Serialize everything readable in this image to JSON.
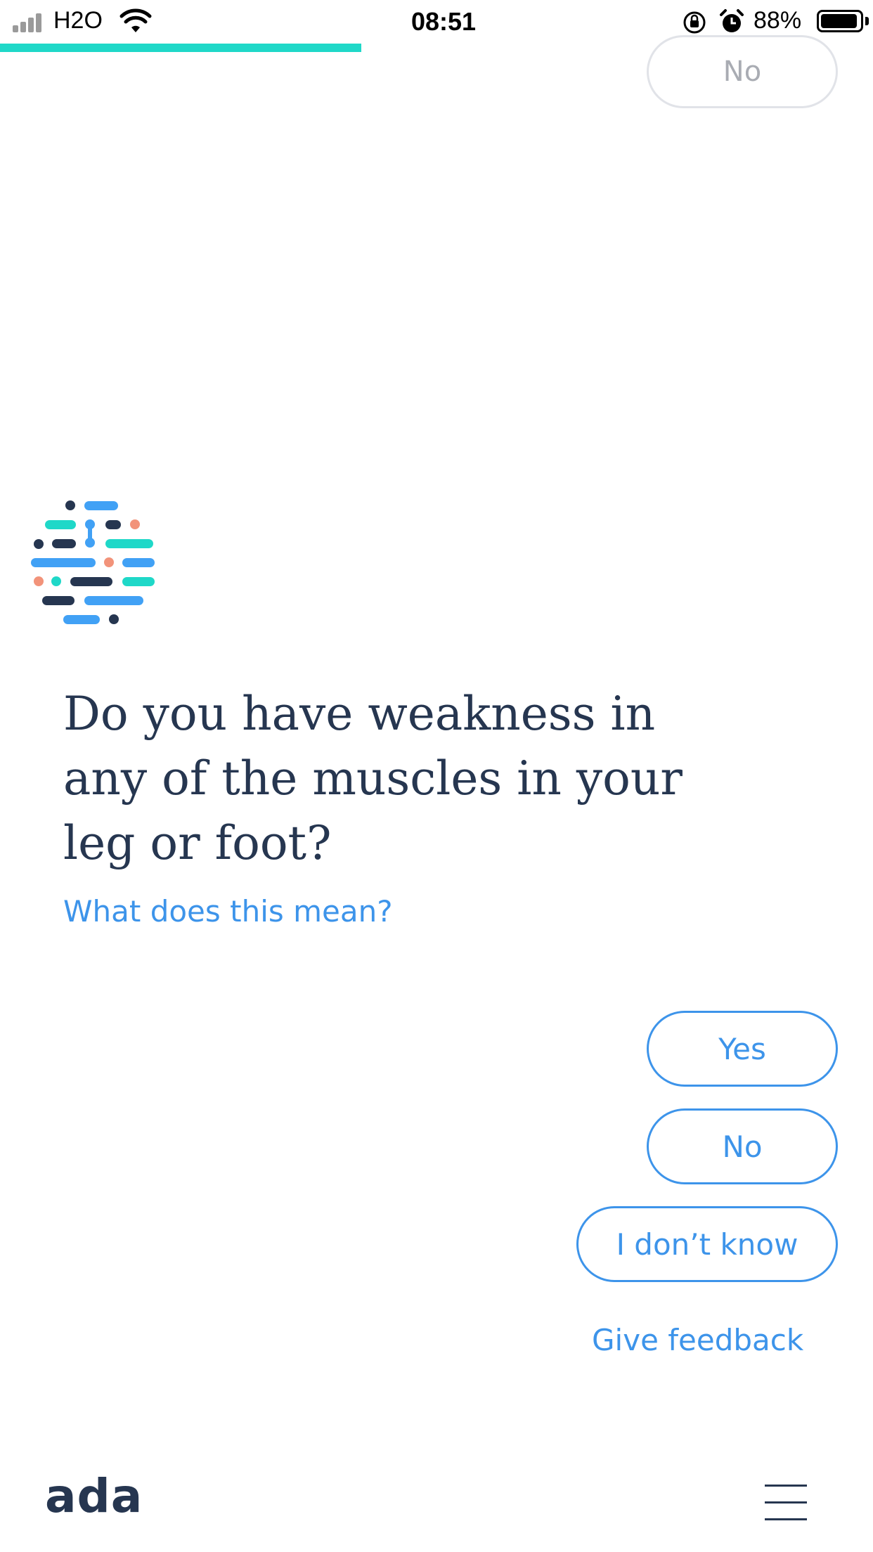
{
  "status_bar": {
    "carrier": "H2O",
    "time": "08:51",
    "battery_percent": "88%"
  },
  "progress": {
    "fraction": 0.414,
    "color": "#1fd8c8"
  },
  "chat": {
    "previous_answer": "No",
    "question": "Do you have weakness in any of the muscles in your leg or foot?",
    "explain_link": "What does this mean?"
  },
  "answers": {
    "yes": "Yes",
    "no": "No",
    "dont_know": "I don’t know"
  },
  "feedback_link": "Give feedback",
  "footer": {
    "brand": "ada",
    "menu_icon": "hamburger-menu-icon"
  },
  "colors": {
    "accent_blue": "#3d94ea",
    "navy": "#263650",
    "teal": "#1fd8c8",
    "coral": "#f2937a",
    "light_blue": "#41a1f5"
  }
}
